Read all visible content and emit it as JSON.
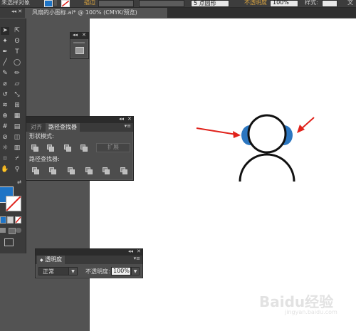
{
  "controlbar": {
    "selection_label": "未选择对象",
    "stroke_label": "描边",
    "stroke_value": "",
    "brush_value": "5 点圆形",
    "opacity_label": "不透明度",
    "opacity_value": "100%",
    "style_label": "样式:",
    "extra_label": "文"
  },
  "document_tab": {
    "title": "风扇的小图标.ai* @ 100% (CMYK/预览)",
    "collapse_icon": "collapse-arrows-icon"
  },
  "pathfinder_panel": {
    "tabs": [
      "对齐",
      "路径查找器"
    ],
    "active_tab": 1,
    "shape_modes_label": "形状模式:",
    "expand_label": "扩展",
    "pathfinders_label": "路径查找器:"
  },
  "transparency_panel": {
    "title": "透明度",
    "blend_mode": "正常",
    "opacity_label": "不透明度:",
    "opacity_value": "100%"
  },
  "colors": {
    "fill": "#1e74c6",
    "earpiece": "#2b76c0",
    "arrow": "#e0221b",
    "ui_bg": "#535353",
    "panel_bg": "#4d4d4d",
    "canvas": "#ffffff"
  },
  "watermark": {
    "text": "Baidu经验",
    "subtext": "jingyan.baidu.com"
  }
}
